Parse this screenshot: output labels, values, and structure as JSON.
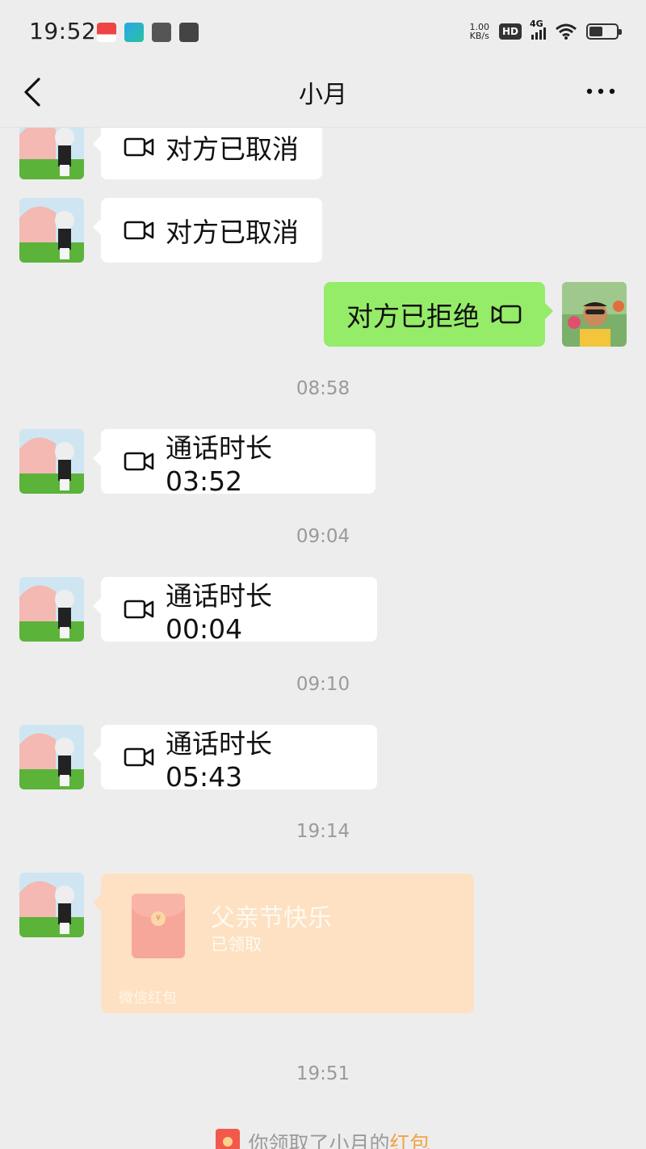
{
  "status_bar": {
    "time": "19:52",
    "net_speed_value": "1.00",
    "net_speed_unit": "KB/s",
    "hd_label": "HD",
    "network_label": "4G",
    "battery_level": 0.5,
    "app_icons": [
      "news-app-icon",
      "send-app-icon",
      "book-app-icon",
      "video-app-icon"
    ]
  },
  "nav": {
    "title": "小月",
    "back_icon": "chevron-left-icon",
    "more_icon": "more-dots-icon"
  },
  "messages": {
    "m1": {
      "text": "对方已取消",
      "icon": "video-call-icon"
    },
    "m2": {
      "text": "对方已取消",
      "icon": "video-call-icon"
    },
    "m3": {
      "text": "对方已拒绝",
      "icon": "video-call-icon"
    },
    "ts1": "08:58",
    "m4": {
      "text": "通话时长 03:52",
      "icon": "video-call-icon"
    },
    "ts2": "09:04",
    "m5": {
      "text": "通话时长 00:04",
      "icon": "video-call-icon"
    },
    "ts3": "09:10",
    "m6": {
      "text": "通话时长 05:43",
      "icon": "video-call-icon"
    },
    "ts4": "19:14",
    "red_packet": {
      "title": "父亲节快乐",
      "status": "已领取",
      "footer": "微信红包"
    },
    "ts5": "19:51",
    "system": {
      "prefix": "你领取了小月的",
      "highlight": "红包"
    }
  },
  "colors": {
    "background": "#ededed",
    "self_bubble": "#95ec69",
    "other_bubble": "#ffffff",
    "red_packet_opened": "#fde1c2",
    "highlight": "#f0a346"
  }
}
